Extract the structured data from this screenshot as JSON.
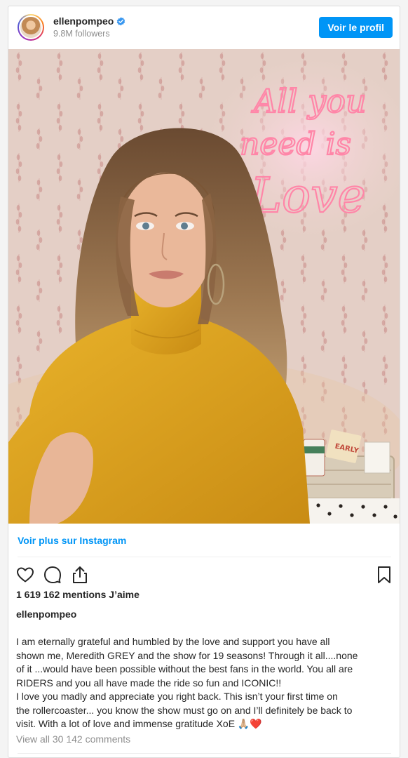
{
  "header": {
    "username": "ellenpompeo",
    "followers": "9.8M followers",
    "profile_button": "Voir le profil"
  },
  "photo": {
    "neon_sign_lines": [
      "All you",
      "need is",
      "Love"
    ],
    "basket_label": "EARLY"
  },
  "links": {
    "more_on_instagram": "Voir plus sur Instagram"
  },
  "post": {
    "likes": "1 619 162 mentions J’aime",
    "caption_username": "ellenpompeo",
    "caption_lines": [
      "I am eternally grateful and humbled by the love and support you have all",
      "shown me, Meredith GREY and the show for 19 seasons! Through it all....none",
      "of it ...would have been possible without the best fans in the world. You all are",
      "RIDERS and you all have made the ride so fun and ICONIC!!",
      "I love you madly and appreciate you right back. This isn’t your first time on",
      "the rollercoaster... you know the show must go on and I’ll definitely be back to",
      "visit. With a lot of love and immense gratitude XoE 🙏🏼❤️"
    ],
    "view_comments": "View all 30 142 comments"
  },
  "icons": [
    "verified-badge-icon",
    "heart-icon",
    "comment-icon",
    "share-icon",
    "bookmark-icon"
  ],
  "colors": {
    "accent": "#0095f6",
    "text": "#262626",
    "muted": "#8e8e8e",
    "neon": "#ff6f91",
    "sweater": "#dca21d"
  }
}
